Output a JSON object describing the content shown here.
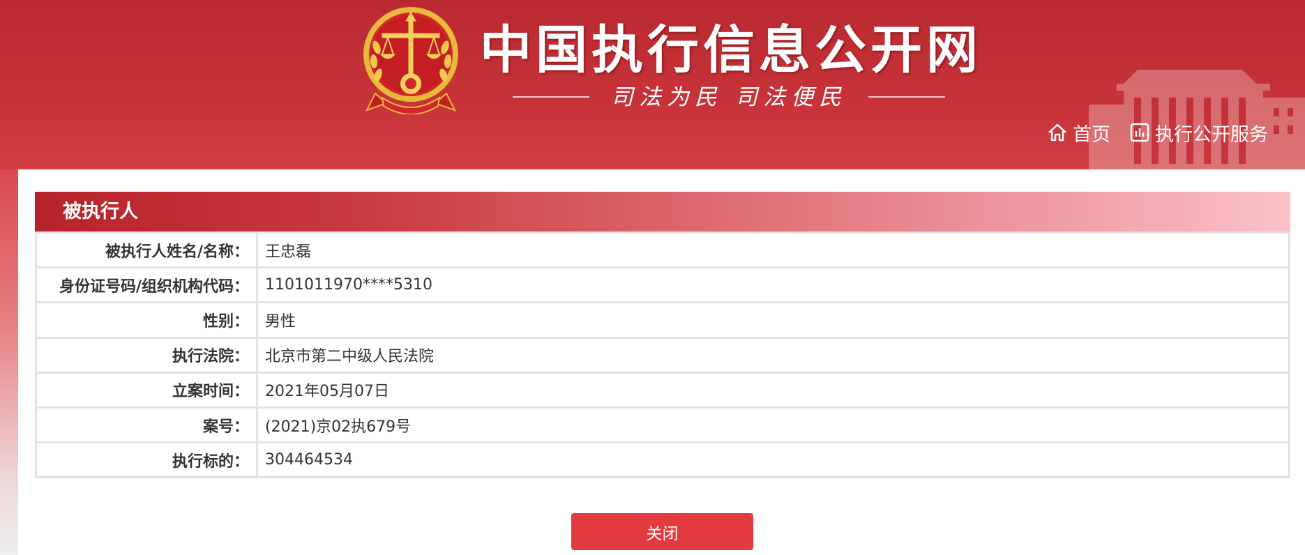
{
  "header": {
    "site_title": "中国执行信息公开网",
    "slogan": "司法为民  司法便民",
    "nav": [
      {
        "label": "首页",
        "icon": "home-icon"
      },
      {
        "label": "执行公开服务",
        "icon": "chart-icon"
      }
    ]
  },
  "section": {
    "title": "被执行人"
  },
  "rows": [
    {
      "label": "被执行人姓名/名称：",
      "value": "王忠磊"
    },
    {
      "label": "身份证号码/组织机构代码：",
      "value": "1101011970****5310"
    },
    {
      "label": "性别：",
      "value": "男性"
    },
    {
      "label": "执行法院：",
      "value": "北京市第二中级人民法院"
    },
    {
      "label": "立案时间：",
      "value": "2021年05月07日"
    },
    {
      "label": "案号：",
      "value": "(2021)京02执679号"
    },
    {
      "label": "执行标的：",
      "value": "304464534"
    }
  ],
  "close_button": {
    "label": "关闭"
  },
  "colors": {
    "banner_red": "#c63238",
    "button_red": "#e23a3e",
    "gold": "#e8b93a"
  }
}
